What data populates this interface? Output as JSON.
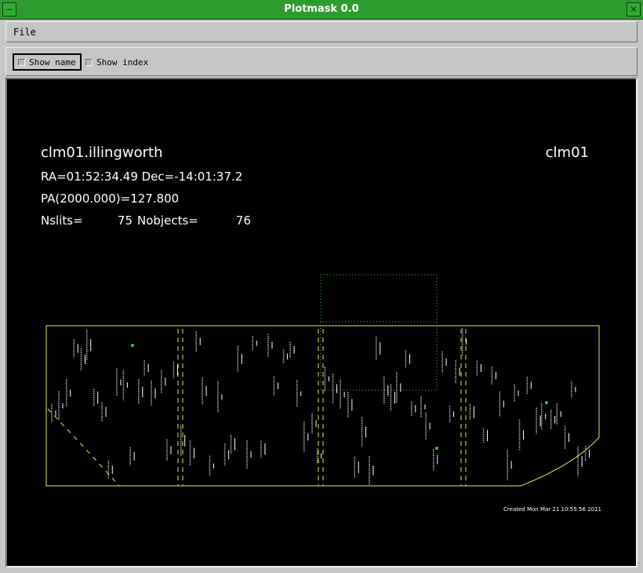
{
  "window": {
    "title": "Plotmask 0.0"
  },
  "menu": {
    "file": "File"
  },
  "toolbar": {
    "show_name": "Show name",
    "show_index": "Show index"
  },
  "plot": {
    "mask_name": "clm01.illingworth",
    "mask_id": "clm01",
    "ra_dec": "RA=01:52:34.49 Dec=-14:01:37.2",
    "pa": "PA(2000.000)=127.800",
    "nslits_label": "Nslits=",
    "nslits": "75",
    "nobjects_label": "Nobjects=",
    "nobjects": "76",
    "created": "Created Mon Mar 21 10:55:56 2011",
    "colors": {
      "background": "#000000",
      "outline": "#ffff66",
      "slit": "#ffffff",
      "guide": "#33cc33"
    }
  }
}
